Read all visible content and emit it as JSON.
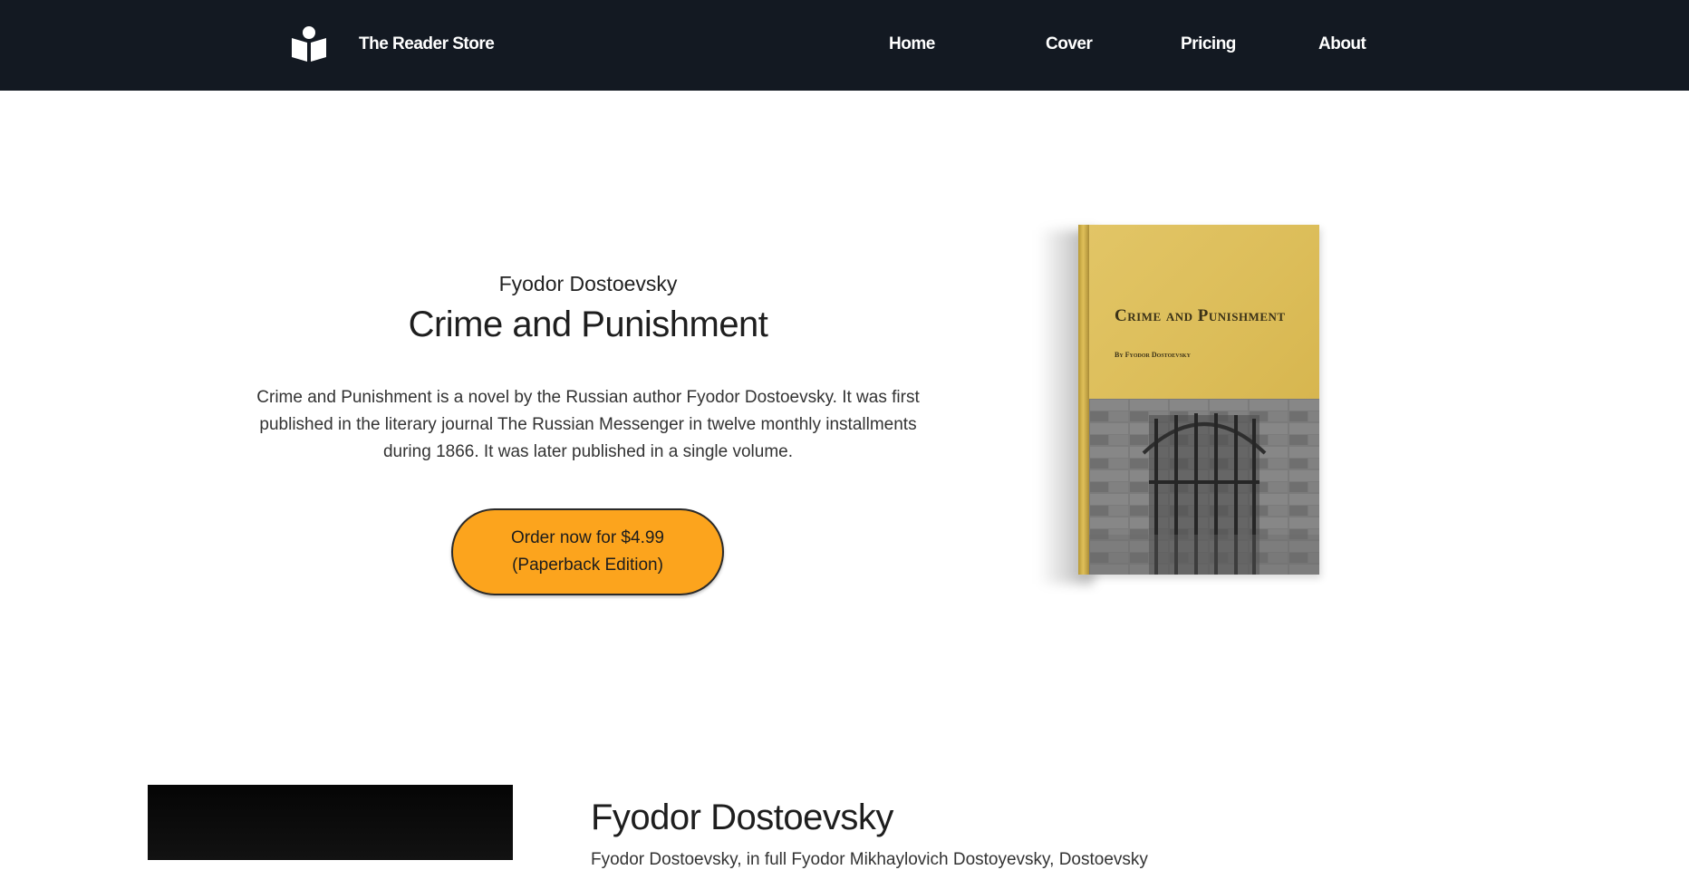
{
  "nav": {
    "brand": "The Reader Store",
    "brand_icon": "book-reader-icon",
    "links": [
      {
        "label": "Home"
      },
      {
        "label": "Cover"
      },
      {
        "label": "Pricing"
      },
      {
        "label": "About"
      }
    ]
  },
  "hero": {
    "author": "Fyodor Dostoevsky",
    "title": "Crime and Punishment",
    "description": "Crime and Punishment is a novel by the Russian author Fyodor Dostoevsky. It was first published in the literary journal The Russian Messenger in twelve monthly installments during 1866. It was later published in a single volume.",
    "order_line1": "Order now for $4.99",
    "order_line2": "(Paperback Edition)"
  },
  "book": {
    "cover_title": "Crime and Punishment",
    "cover_byline": "By Fyodor Dostoevsky",
    "cover_color": "#dcbd59"
  },
  "author_section": {
    "heading": "Fyodor Dostoevsky",
    "bio_preview": "Fyodor Dostoevsky, in full Fyodor Mikhaylovich Dostoyevsky, Dostoevsky"
  },
  "colors": {
    "nav_bg": "#131922",
    "accent": "#fca41d"
  }
}
